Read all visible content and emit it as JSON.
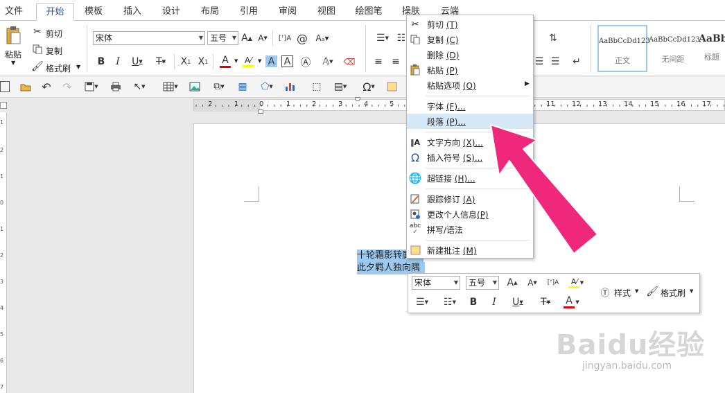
{
  "tabs": [
    "文件",
    "开始",
    "模板",
    "插入",
    "设计",
    "布局",
    "引用",
    "审阅",
    "视图",
    "绘图笔",
    "操肤",
    "云端"
  ],
  "active_tab": "开始",
  "clipboard": {
    "paste": "粘贴",
    "cut": "剪切",
    "copy": "复制",
    "format_painter": "格式刷"
  },
  "font": {
    "name": "宋体",
    "size": "五号"
  },
  "styles": [
    {
      "sample": "AaBbCcDd123",
      "name": "正文"
    },
    {
      "sample": "AaBbCcDd123",
      "name": "无间距"
    },
    {
      "sample": "AaBb",
      "name": "标题"
    }
  ],
  "ruler_numbers": [
    "2",
    "1",
    "0",
    "1",
    "2",
    "3",
    "4",
    "5",
    "11",
    "12",
    "13",
    "14",
    "15",
    "16",
    "17"
  ],
  "vruler_numbers": [
    "1",
    "2",
    "1",
    "0",
    "1",
    "2",
    "3",
    "4",
    "5",
    "6",
    "7"
  ],
  "document_lines": [
    "十轮霜影转庭梧",
    "此夕羁人独向隅"
  ],
  "context_menu": [
    {
      "label": "剪切",
      "key": "(T)",
      "icon": "scissors-icon"
    },
    {
      "label": "复制",
      "key": "(C)",
      "icon": "copy-icon"
    },
    {
      "label": "删除",
      "key": "(D)",
      "icon": ""
    },
    {
      "label": "粘贴",
      "key": "(P)",
      "icon": "paste-icon"
    },
    {
      "label": "粘贴选项",
      "key": "(O)",
      "icon": ""
    },
    {
      "label": "字体",
      "key": "(F)...",
      "icon": ""
    },
    {
      "label": "段落",
      "key": "(P)...",
      "icon": ""
    },
    {
      "label": "文字方向",
      "key": "(X)...",
      "icon": "text-direction-icon"
    },
    {
      "label": "插入符号",
      "key": "(S)...",
      "icon": "omega-icon"
    },
    {
      "label": "超链接",
      "key": "(H)...",
      "icon": "globe-icon"
    },
    {
      "label": "跟踪修订",
      "key": "(A)",
      "icon": "track-changes-icon"
    },
    {
      "label": "更改个人信息",
      "key": "(P)",
      "icon": "user-info-icon"
    },
    {
      "label": "拼写/语法",
      "key": "",
      "icon": "spellcheck-icon"
    },
    {
      "label": "新建批注",
      "key": "(M)",
      "icon": "comment-icon"
    }
  ],
  "mini_toolbar": {
    "font": "宋体",
    "size": "五号",
    "style_label": "样式",
    "painter_label": "格式刷"
  },
  "watermark": {
    "brand": "Baidu经验",
    "url": "jingyan.baidu.com"
  },
  "colors": {
    "arrow": "#f0287b",
    "font_red": "#e00000",
    "highlight": "#ffff00",
    "selection": "#9cc9ef",
    "accent": "#2b579a"
  }
}
